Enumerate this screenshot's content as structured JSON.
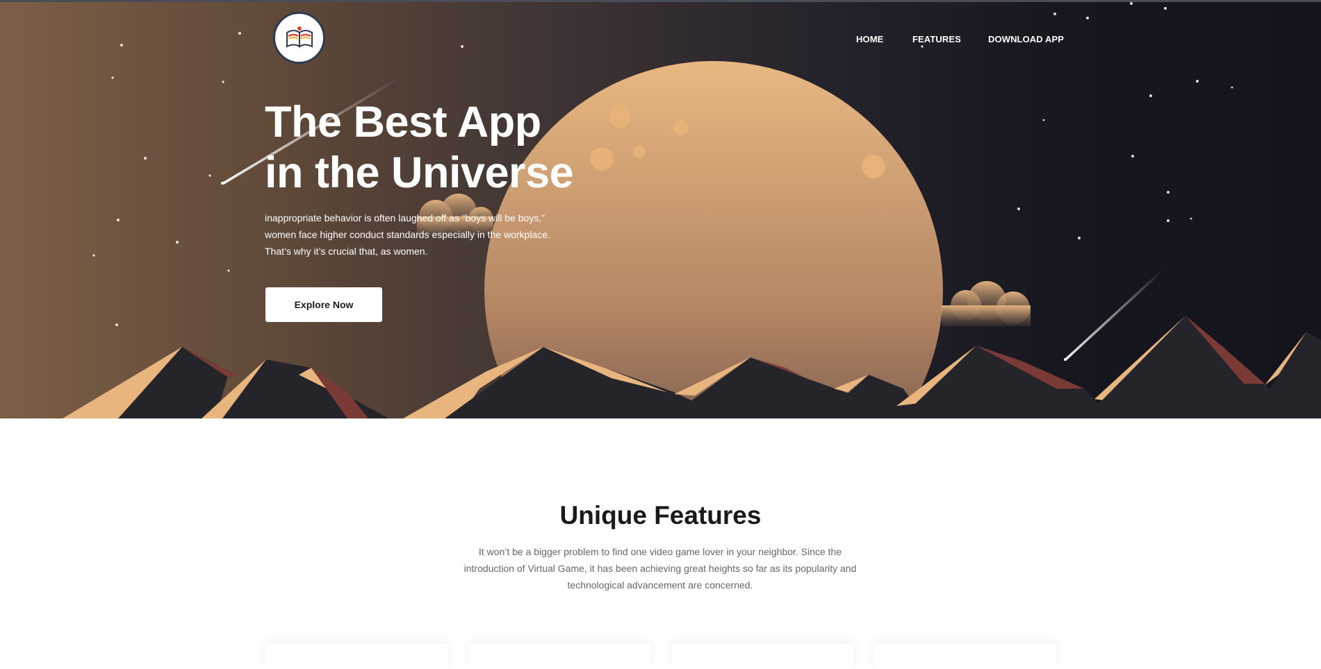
{
  "colors": {
    "hero_left": "#7d5f47",
    "hero_right": "#13141c",
    "planet": "#d9a873",
    "mountain_dark": "#26242b",
    "mountain_light": "#e8b57f",
    "mountain_red": "#7a3a35",
    "button_bg": "#ffffff",
    "heading_dark": "#1a1a1a",
    "body_gray": "#666666"
  },
  "header": {
    "logo_icon": "open-book-logo-icon",
    "nav": [
      {
        "label": "HOME"
      },
      {
        "label": "FEATURES"
      },
      {
        "label": "DOWNLOAD APP"
      }
    ]
  },
  "hero": {
    "title_line1": "The Best App",
    "title_line2": "in the Universe",
    "desc_line1": "inappropriate behavior is often laughed off as “boys will be boys,”",
    "desc_line2": "women face higher conduct standards especially in the workplace.",
    "desc_line3": "That’s why it’s crucial that, as women.",
    "cta_label": "Explore Now"
  },
  "features": {
    "title": "Unique Features",
    "desc_line1": "It won’t be a bigger problem to find one video game lover in your neighbor. Since the",
    "desc_line2": "introduction of Virtual Game, it has been achieving great heights so far as its popularity and",
    "desc_line3": "technological advancement are concerned.",
    "cards": [
      {
        "id": "card-1"
      },
      {
        "id": "card-2"
      },
      {
        "id": "card-3"
      },
      {
        "id": "card-4"
      }
    ]
  }
}
